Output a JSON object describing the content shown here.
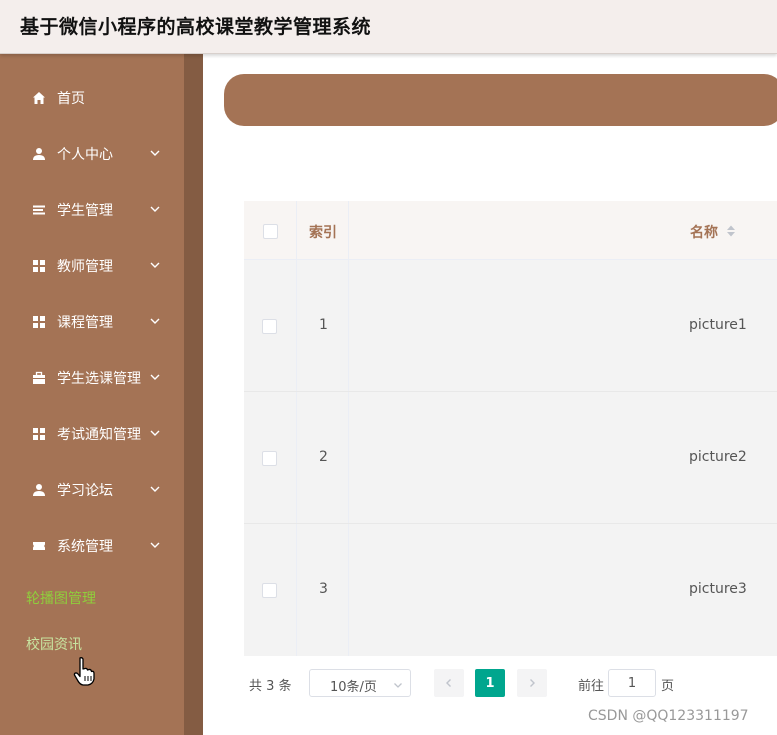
{
  "header": {
    "title": "基于微信小程序的高校课堂教学管理系统"
  },
  "sidebar": {
    "items": [
      {
        "label": "首页",
        "icon": "home-icon"
      },
      {
        "label": "个人中心",
        "icon": "user-icon"
      },
      {
        "label": "学生管理",
        "icon": "list-icon"
      },
      {
        "label": "教师管理",
        "icon": "grid-icon"
      },
      {
        "label": "课程管理",
        "icon": "grid-icon"
      },
      {
        "label": "学生选课管理",
        "icon": "briefcase-icon"
      },
      {
        "label": "考试通知管理",
        "icon": "grid-icon"
      },
      {
        "label": "学习论坛",
        "icon": "user-icon"
      },
      {
        "label": "系统管理",
        "icon": "ticket-icon"
      }
    ],
    "subitems": [
      {
        "label": "轮播图管理"
      },
      {
        "label": "校园资讯"
      }
    ]
  },
  "table": {
    "headers": {
      "index": "索引",
      "name": "名称"
    },
    "rows": [
      {
        "index": "1",
        "name": "picture1"
      },
      {
        "index": "2",
        "name": "picture2"
      },
      {
        "index": "3",
        "name": "picture3"
      }
    ]
  },
  "pagination": {
    "total": "共 3 条",
    "page_size": "10条/页",
    "current_page": "1",
    "goto_label": "前往",
    "goto_value": "1",
    "goto_suffix": "页"
  },
  "watermark": "CSDN @QQ123311197",
  "colors": {
    "brand": "#a47355",
    "sidebar_edge": "#845c43",
    "active_page": "#00a68e",
    "sub_item": "#8fce3c"
  }
}
